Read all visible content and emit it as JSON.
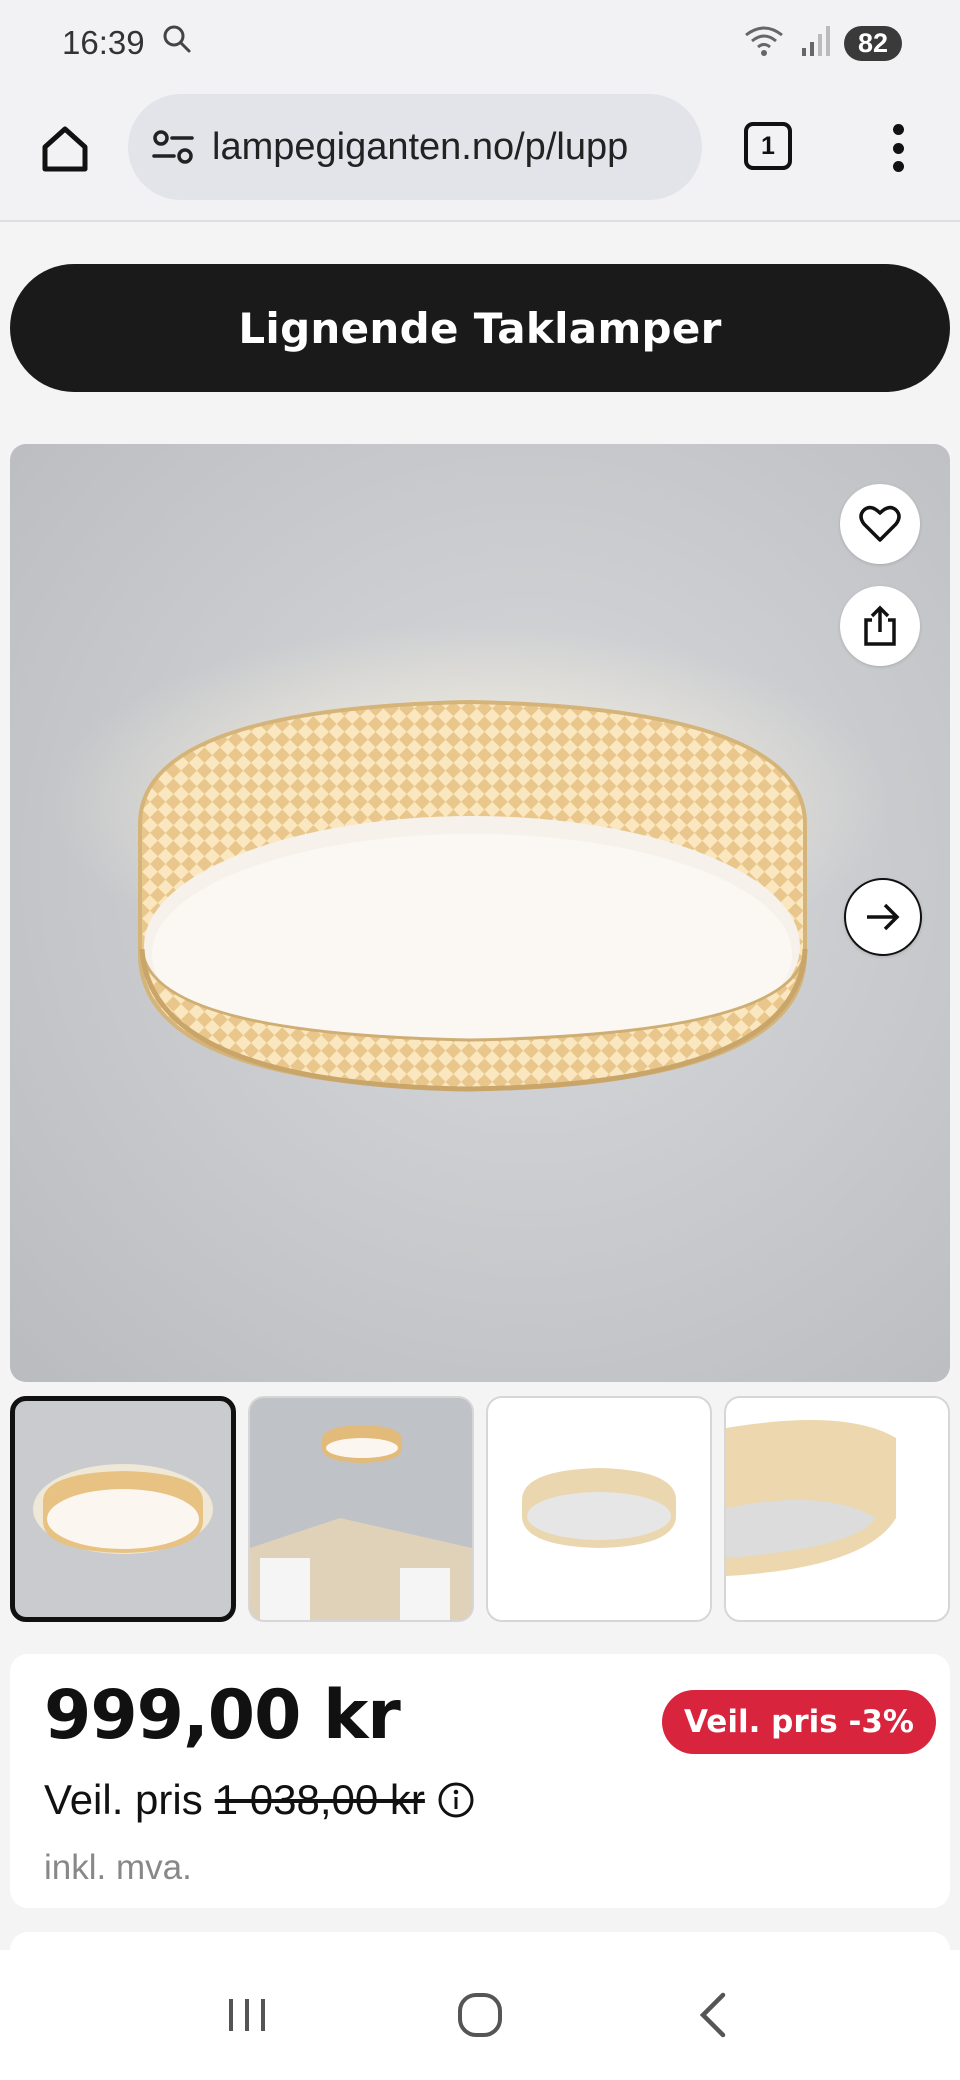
{
  "status_bar": {
    "time": "16:39",
    "battery": "82"
  },
  "browser": {
    "url": "lampegiganten.no/p/lupp",
    "tab_count": "1"
  },
  "page": {
    "similar_button": "Lignende Taklamper",
    "price": "999,00 kr",
    "discount_badge": "Veil. pris -3%",
    "ref_label": "Veil. pris",
    "ref_price": "1 038,00 kr",
    "vat_note": "inkl. mva."
  },
  "thumbnails": [
    {
      "name": "thumb-1",
      "active": true
    },
    {
      "name": "thumb-2",
      "active": false
    },
    {
      "name": "thumb-3",
      "active": false
    },
    {
      "name": "thumb-4",
      "active": false
    }
  ],
  "colors": {
    "accent": "#d9243e",
    "button_dark": "#1a1a1a"
  }
}
